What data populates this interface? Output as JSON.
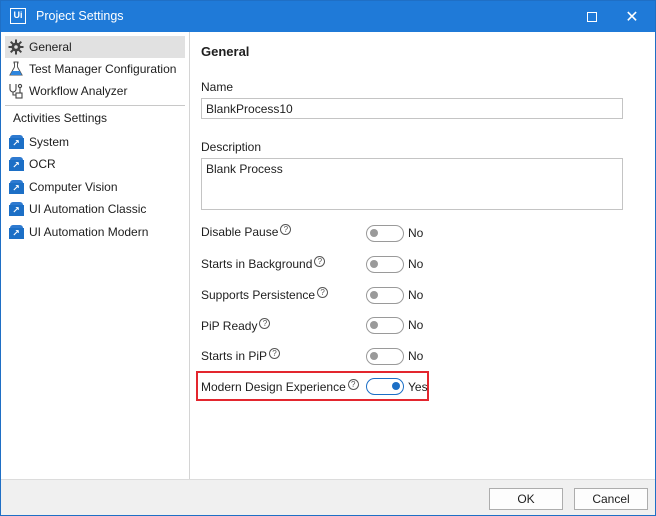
{
  "window": {
    "title": "Project Settings",
    "logo_text": "Ui"
  },
  "sidebar": {
    "items": [
      {
        "label": "General",
        "icon": "gear-icon",
        "selected": true
      },
      {
        "label": "Test Manager Configuration",
        "icon": "flask-icon",
        "selected": false
      },
      {
        "label": "Workflow Analyzer",
        "icon": "workflow-analyzer-icon",
        "selected": false
      }
    ],
    "section_label": "Activities Settings",
    "activities": [
      {
        "label": "System",
        "icon": "activity-package-icon"
      },
      {
        "label": "OCR",
        "icon": "activity-package-icon"
      },
      {
        "label": "Computer Vision",
        "icon": "activity-package-icon"
      },
      {
        "label": "UI Automation Classic",
        "icon": "activity-package-icon"
      },
      {
        "label": "UI Automation Modern",
        "icon": "activity-package-icon"
      }
    ]
  },
  "main": {
    "heading": "General",
    "name_label": "Name",
    "name_value": "BlankProcess10",
    "description_label": "Description",
    "description_value": "Blank Process",
    "options": [
      {
        "label": "Disable Pause",
        "state": "No",
        "on": false
      },
      {
        "label": "Starts in Background",
        "state": "No",
        "on": false
      },
      {
        "label": "Supports Persistence",
        "state": "No",
        "on": false
      },
      {
        "label": "PiP Ready",
        "state": "No",
        "on": false
      },
      {
        "label": "Starts in PiP",
        "state": "No",
        "on": false
      },
      {
        "label": "Modern Design Experience",
        "state": "Yes",
        "on": true
      }
    ],
    "help_glyph": "?",
    "highlight_color": "#e3262e"
  },
  "footer": {
    "ok_label": "OK",
    "cancel_label": "Cancel"
  },
  "colors": {
    "titlebar": "#1f7ad8",
    "accent": "#1c6fc6"
  }
}
